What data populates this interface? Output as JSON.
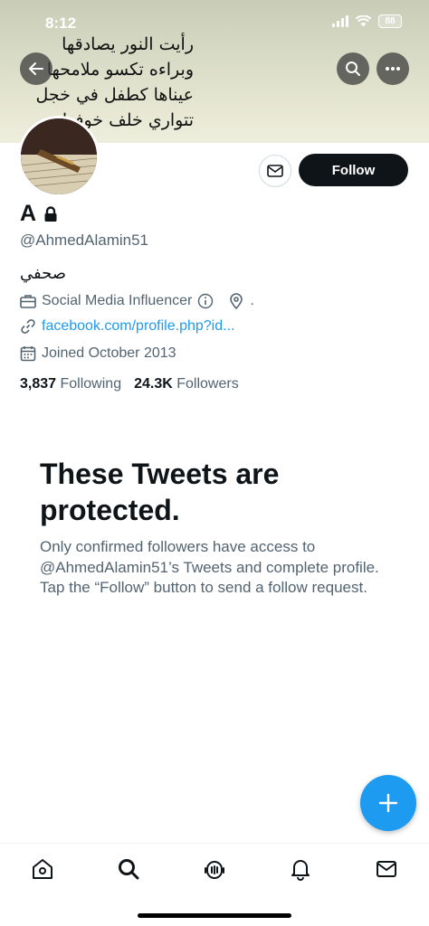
{
  "status_bar": {
    "time": "8:12",
    "battery": "88"
  },
  "banner": {
    "poem_lines": [
      "رأيت النور يصادقها",
      "وبراءه تكسو ملامحها",
      "عيناها كطفل في خجل",
      "تتواري خلف خوفها"
    ]
  },
  "header": {
    "back_icon": "arrow-left-icon",
    "search_icon": "search-icon",
    "more_icon": "more-horizontal-icon"
  },
  "profile": {
    "follow_label": "Follow",
    "name": "A",
    "handle": "@AhmedAlamin51",
    "bio": "صحفي",
    "category": "Social Media Influencer",
    "location": ".",
    "website": "facebook.com/profile.php?id...",
    "joined": "Joined October 2013",
    "following_count": "3,837",
    "following_label": "Following",
    "followers_count": "24.3K",
    "followers_label": "Followers"
  },
  "protected": {
    "title": "These Tweets are protected.",
    "body": "Only confirmed followers have access to @AhmedAlamin51’s Tweets and complete profile. Tap the “Follow” button to send a follow request."
  },
  "tabs": [
    "home-icon",
    "search-icon",
    "spaces-icon",
    "notifications-icon",
    "messages-icon"
  ],
  "colors": {
    "accent": "#1d9bf0",
    "text": "#0f1419",
    "secondary": "#536471"
  }
}
